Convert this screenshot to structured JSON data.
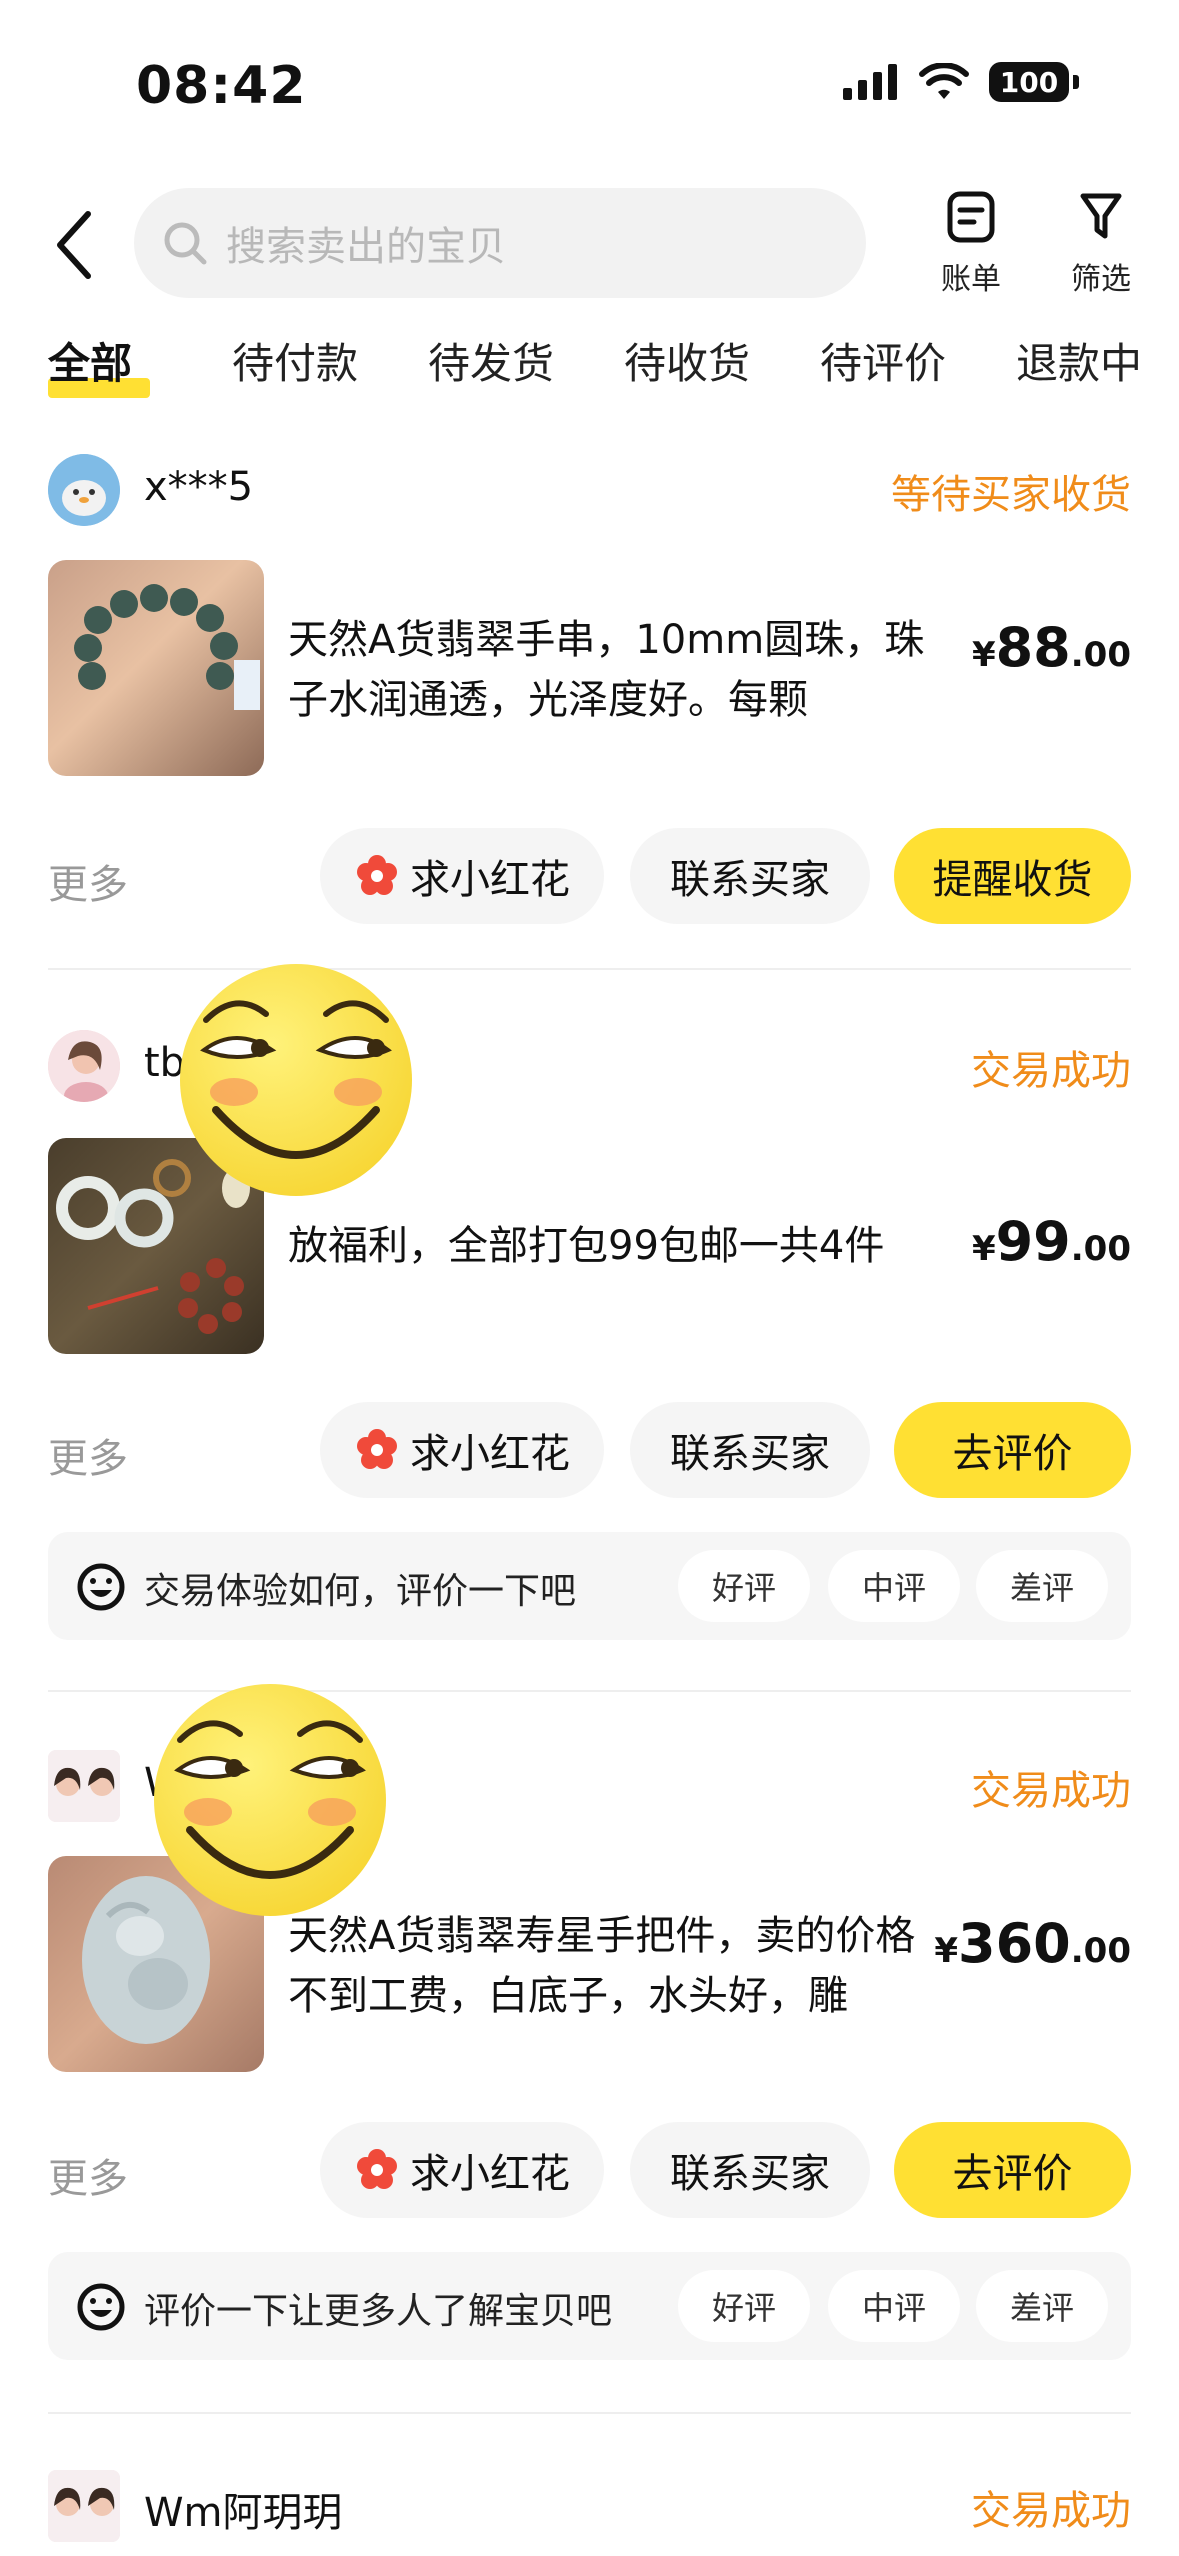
{
  "status_bar": {
    "time": "08:42",
    "battery": "100"
  },
  "header": {
    "search_placeholder": "搜索卖出的宝贝",
    "bill_label": "账单",
    "filter_label": "筛选"
  },
  "tabs": [
    "全部",
    "待付款",
    "待发货",
    "待收货",
    "待评价",
    "退款中"
  ],
  "orders": [
    {
      "user": "x***5",
      "status": "等待买家收货",
      "title": "天然A货翡翠手串，10mm圆珠，珠子水润通透，光泽度好。每颗",
      "price_yen": "¥",
      "price_int": "88",
      "price_dec": ".00",
      "more": "更多",
      "btn_flower": "求小红花",
      "btn_contact": "联系买家",
      "btn_primary": "提醒收货"
    },
    {
      "user": "tb",
      "status": "交易成功",
      "title": "放福利，全部打包99包邮一共4件",
      "price_yen": "¥",
      "price_int": "99",
      "price_dec": ".00",
      "more": "更多",
      "btn_flower": "求小红花",
      "btn_contact": "联系买家",
      "btn_primary": "去评价",
      "rate_prompt": "交易体验如何，评价一下吧",
      "rate_good": "好评",
      "rate_mid": "中评",
      "rate_bad": "差评"
    },
    {
      "user": "W",
      "status": "交易成功",
      "title": "天然A货翡翠寿星手把件，卖的价格不到工费，白底子，水头好，雕",
      "price_yen": "¥",
      "price_int": "360",
      "price_dec": ".00",
      "more": "更多",
      "btn_flower": "求小红花",
      "btn_contact": "联系买家",
      "btn_primary": "去评价",
      "rate_prompt": "评价一下让更多人了解宝贝吧",
      "rate_good": "好评",
      "rate_mid": "中评",
      "rate_bad": "差评"
    },
    {
      "user": "Wm阿玥玥",
      "status": "交易成功"
    }
  ],
  "colors": {
    "accent_yellow": "#ffe033",
    "status_orange": "#f08c1a"
  }
}
